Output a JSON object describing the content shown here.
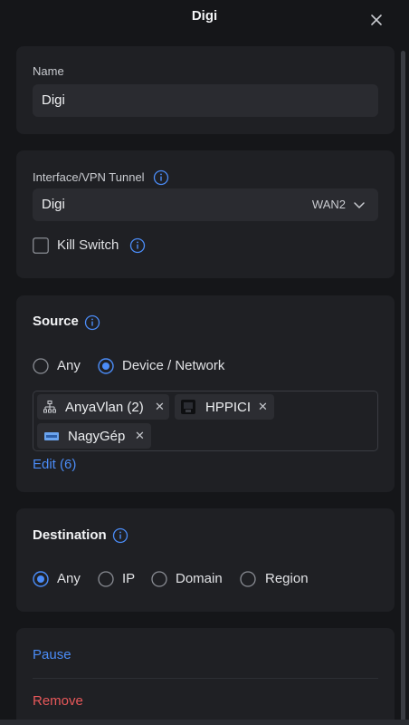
{
  "header": {
    "title": "Digi"
  },
  "name_card": {
    "label": "Name",
    "value": "Digi"
  },
  "interface_card": {
    "label": "Interface/VPN Tunnel",
    "selected_name": "Digi",
    "selected_port": "WAN2",
    "kill_switch_label": "Kill Switch",
    "kill_switch_checked": false
  },
  "source": {
    "title": "Source",
    "options": [
      {
        "label": "Any",
        "selected": false
      },
      {
        "label": "Device / Network",
        "selected": true
      }
    ],
    "chips": [
      {
        "label": "AnyaVlan (2)",
        "icon": "network-topology-icon"
      },
      {
        "label": "HPPICI",
        "icon": "device-thumbnail-icon"
      },
      {
        "label": "NagyGép",
        "icon": "device-card-icon"
      }
    ],
    "edit_label": "Edit (6)"
  },
  "destination": {
    "title": "Destination",
    "options": [
      {
        "label": "Any",
        "selected": true
      },
      {
        "label": "IP",
        "selected": false
      },
      {
        "label": "Domain",
        "selected": false
      },
      {
        "label": "Region",
        "selected": false
      }
    ]
  },
  "actions": {
    "pause_label": "Pause",
    "remove_label": "Remove"
  },
  "colors": {
    "accent": "#4b8cf7",
    "danger": "#e8585a",
    "card": "#1f2024",
    "background": "#151619"
  }
}
